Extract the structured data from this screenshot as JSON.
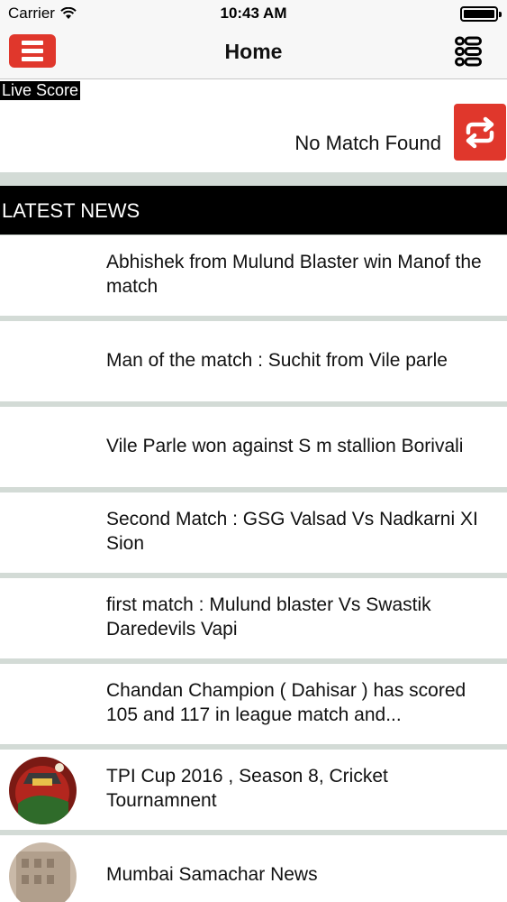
{
  "status_bar": {
    "carrier": "Carrier",
    "time": "10:43 AM"
  },
  "nav": {
    "title": "Home",
    "menu_icon": "hamburger-icon",
    "list_icon": "list-icon"
  },
  "live_score": {
    "label": "Live Score",
    "message": "No Match Found",
    "refresh_icon": "refresh-icon"
  },
  "latest_news": {
    "header": "LATEST NEWS",
    "items": [
      {
        "title": "Abhishek from Mulund Blaster win Manof the match"
      },
      {
        "title": "Man of the match : Suchit from Vile parle"
      },
      {
        "title": "Vile Parle won against S m stallion Borivali"
      },
      {
        "title": "Second Match : GSG Valsad Vs Nadkarni XI Sion"
      },
      {
        "title": "first match : Mulund blaster Vs Swastik Daredevils Vapi"
      },
      {
        "title": "Chandan Champion ( Dahisar ) has scored 105 and 117 in league match and..."
      },
      {
        "title": "TPI Cup 2016 , Season 8, Cricket Tournamnent"
      },
      {
        "title": "Mumbai Samachar News"
      }
    ]
  },
  "colors": {
    "accent": "#e0372c",
    "separator": "#d3dbd6"
  }
}
